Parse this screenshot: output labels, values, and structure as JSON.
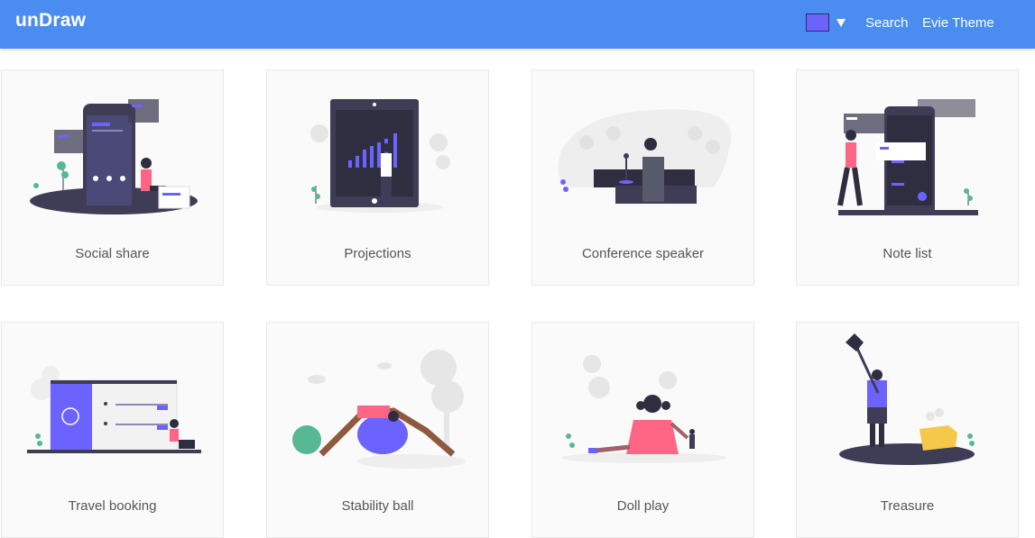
{
  "header": {
    "logo": "unDraw",
    "color_swatch": "#6c63ff",
    "nav": {
      "search": "Search",
      "theme": "Evie Theme"
    }
  },
  "colors": {
    "bar": "#4a8cf0",
    "accent": "#6c63ff",
    "dark": "#3f3d56",
    "skin": "#a0616a",
    "pink": "#ff6584",
    "leaf": "#57b894"
  },
  "illustrations": [
    {
      "label": "Social share",
      "icon": "social-share-illustration"
    },
    {
      "label": "Projections",
      "icon": "projections-illustration"
    },
    {
      "label": "Conference speaker",
      "icon": "conference-speaker-illustration"
    },
    {
      "label": "Note list",
      "icon": "note-list-illustration"
    },
    {
      "label": "Travel booking",
      "icon": "travel-booking-illustration"
    },
    {
      "label": "Stability ball",
      "icon": "stability-ball-illustration"
    },
    {
      "label": "Doll play",
      "icon": "doll-play-illustration"
    },
    {
      "label": "Treasure",
      "icon": "treasure-illustration"
    }
  ]
}
